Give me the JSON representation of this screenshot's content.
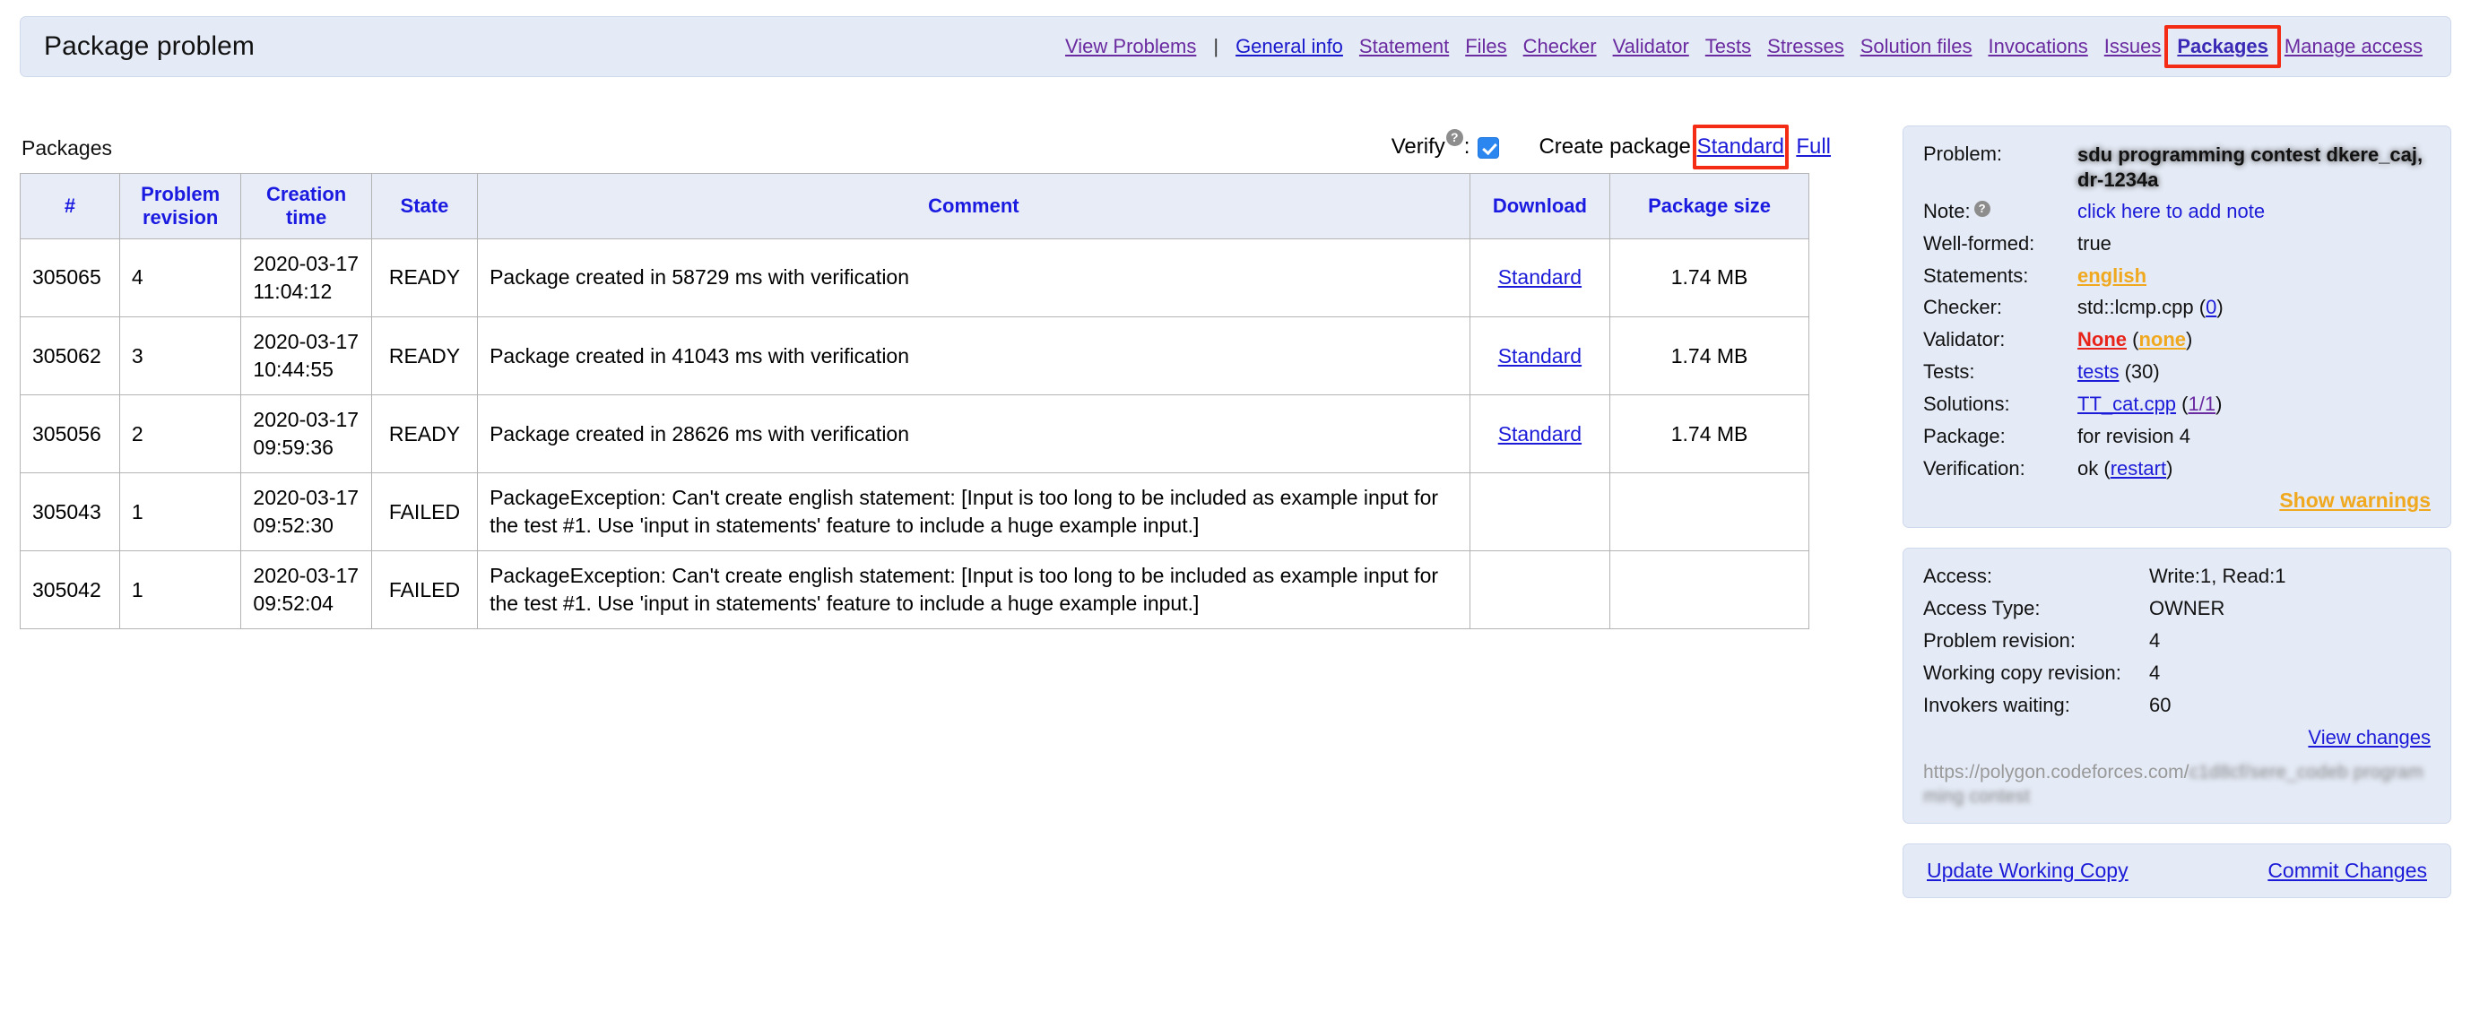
{
  "header": {
    "title": "Package problem",
    "nav": [
      {
        "label": "View Problems",
        "style": "visited"
      },
      {
        "label": "|",
        "style": "sep"
      },
      {
        "label": "General info",
        "style": "blue"
      },
      {
        "label": "Statement",
        "style": "visited"
      },
      {
        "label": "Files",
        "style": "visited"
      },
      {
        "label": "Checker",
        "style": "visited"
      },
      {
        "label": "Validator",
        "style": "visited"
      },
      {
        "label": "Tests",
        "style": "visited"
      },
      {
        "label": "Stresses",
        "style": "visited"
      },
      {
        "label": "Solution files",
        "style": "visited"
      },
      {
        "label": "Invocations",
        "style": "visited"
      },
      {
        "label": "Issues",
        "style": "visited"
      },
      {
        "label": "Packages",
        "style": "current",
        "highlighted": true
      },
      {
        "label": "Manage access",
        "style": "visited"
      }
    ]
  },
  "main": {
    "section_label": "Packages",
    "verify": {
      "label": "Verify",
      "help_icon": "?",
      "colon": ":",
      "checked": true
    },
    "create_package": {
      "label": "Create package",
      "standard_link": "Standard",
      "comma": ",",
      "full_link": "Full",
      "highlighted_link": "Standard"
    },
    "table": {
      "columns": [
        "#",
        "Problem revision",
        "Creation time",
        "State",
        "Comment",
        "Download",
        "Package size"
      ],
      "rows": [
        {
          "id": "305065",
          "revision": "4",
          "date": "2020-03-17",
          "time": "11:04:12",
          "state": "READY",
          "comment": "Package created in 58729 ms with verification",
          "download": "Standard",
          "size": "1.74 MB"
        },
        {
          "id": "305062",
          "revision": "3",
          "date": "2020-03-17",
          "time": "10:44:55",
          "state": "READY",
          "comment": "Package created in 41043 ms with verification",
          "download": "Standard",
          "size": "1.74 MB"
        },
        {
          "id": "305056",
          "revision": "2",
          "date": "2020-03-17",
          "time": "09:59:36",
          "state": "READY",
          "comment": "Package created in 28626 ms with verification",
          "download": "Standard",
          "size": "1.74 MB"
        },
        {
          "id": "305043",
          "revision": "1",
          "date": "2020-03-17",
          "time": "09:52:30",
          "state": "FAILED",
          "comment": "PackageException: Can't create english statement: [Input is too long to be included as example input for the test #1. Use 'input in statements' feature to include a huge example input.]",
          "download": "",
          "size": ""
        },
        {
          "id": "305042",
          "revision": "1",
          "date": "2020-03-17",
          "time": "09:52:04",
          "state": "FAILED",
          "comment": "PackageException: Can't create english statement: [Input is too long to be included as example input for the test #1. Use 'input in statements' feature to include a huge example input.]",
          "download": "",
          "size": ""
        }
      ]
    }
  },
  "sidebar": {
    "info": {
      "problem_label": "Problem:",
      "problem_value": "sdu programming contest dkere_caj, dr-1234a",
      "note_label": "Note:",
      "note_help_icon": "?",
      "note_link": "click here to add note",
      "wellformed_label": "Well-formed:",
      "wellformed_value": "true",
      "statements_label": "Statements:",
      "statements_value": "english",
      "checker_label": "Checker:",
      "checker_value": "std::lcmp.cpp",
      "checker_count": "0",
      "validator_label": "Validator:",
      "validator_value": "None",
      "validator_sub": "none",
      "tests_label": "Tests:",
      "tests_link": "tests",
      "tests_count": "30",
      "solutions_label": "Solutions:",
      "solutions_link": "TT_cat.cpp",
      "solutions_count": "1/1",
      "package_label": "Package:",
      "package_value": "for revision 4",
      "verification_label": "Verification:",
      "verification_value": "ok",
      "verification_link": "restart",
      "show_warnings": "Show warnings"
    },
    "access": {
      "access_label": "Access:",
      "access_value": "Write:1, Read:1",
      "access_type_label": "Access Type:",
      "access_type_value": "OWNER",
      "problem_revision_label": "Problem revision:",
      "problem_revision_value": "4",
      "working_copy_label": "Working copy revision:",
      "working_copy_value": "4",
      "invokers_label": "Invokers waiting:",
      "invokers_value": "60",
      "view_changes": "View changes",
      "url_visible": "https://polygon.codeforces.com/",
      "url_blurred": "c1d8cf/sere_codeb programming contest"
    },
    "actions": {
      "update_working_copy": "Update Working Copy",
      "commit_changes": "Commit Changes"
    }
  },
  "colors": {
    "panel_bg": "#e5ebf6",
    "link_blue": "#1b1bd8",
    "link_visited": "#6a2aa0",
    "orange": "#f0a81e",
    "red_annotation": "#f42b15",
    "header_blue": "#1a1ae0"
  }
}
